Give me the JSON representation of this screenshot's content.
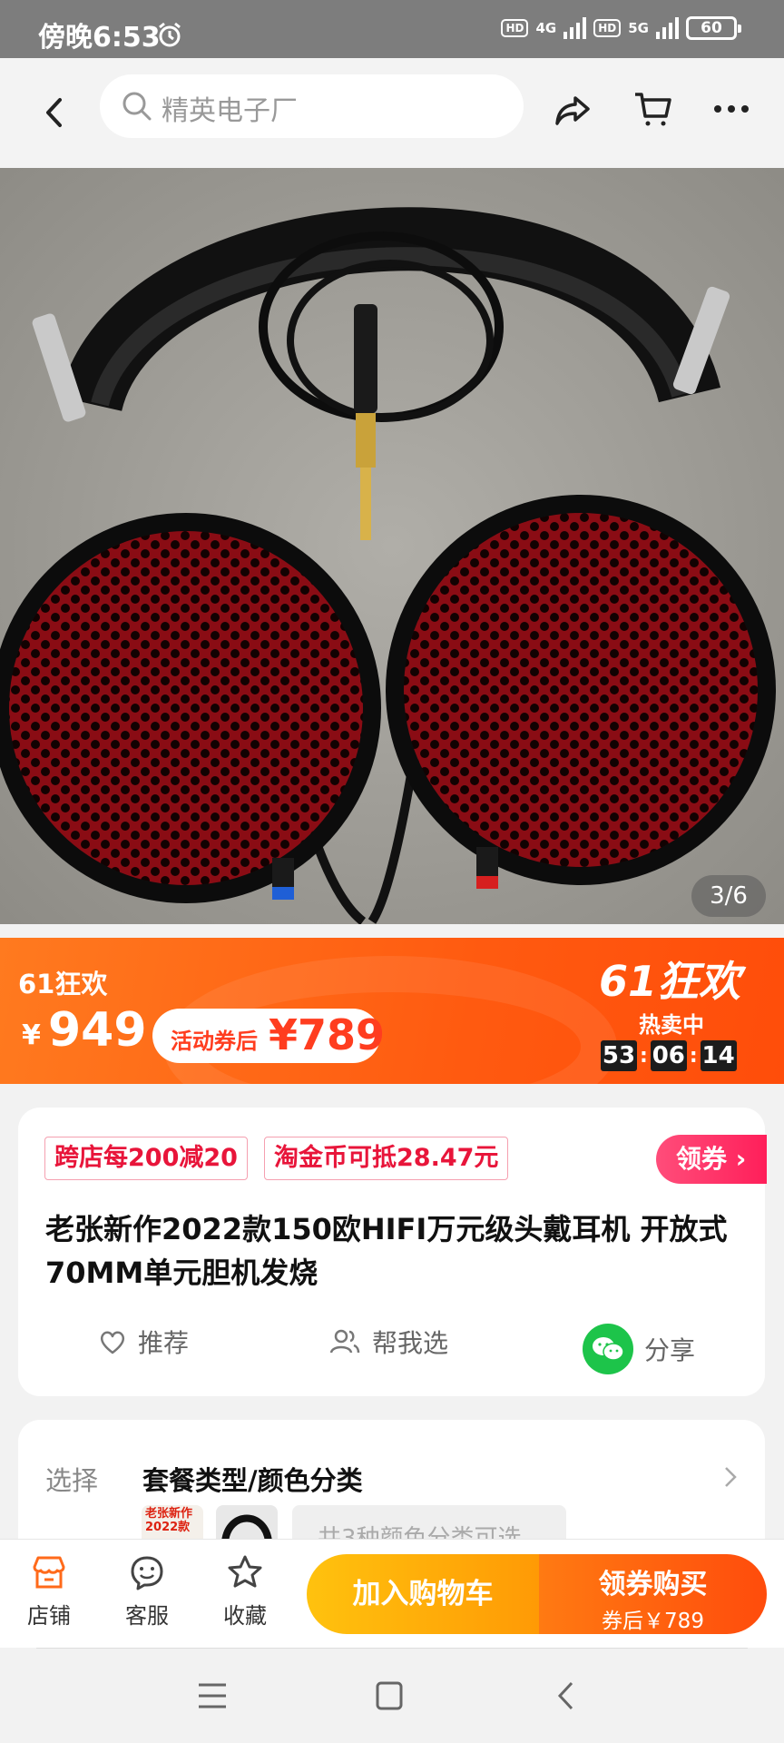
{
  "status_bar": {
    "time": "傍晚6:53",
    "net1": "4G",
    "net2": "5G",
    "hd": "HD",
    "battery": "60"
  },
  "nav": {
    "search_text": "精英电子厂",
    "icons": [
      "back-icon",
      "search-icon",
      "share-icon",
      "cart-icon",
      "more-icon"
    ]
  },
  "gallery": {
    "counter": "3/6"
  },
  "promo": {
    "tag": "61狂欢",
    "currency": "¥",
    "price": "949",
    "coupon_label": "活动券后",
    "coupon_price": "¥789",
    "brand": "61狂欢",
    "hot": "热卖中",
    "timer": [
      "53",
      "06",
      "14"
    ],
    "colors": {
      "band": "#ff5a10",
      "pill_text": "#ff3d1f"
    }
  },
  "product": {
    "coupons": [
      "跨店每200减20",
      "淘金币可抵28.47元"
    ],
    "get_coupon": "领券 ›",
    "title": "老张新作2022款150欧HIFI万元级头戴耳机 开放式70MM单元胆机发烧",
    "actions": {
      "recommend": "推荐",
      "help_choose": "帮我选",
      "share": "分享"
    }
  },
  "options": {
    "label": "选择",
    "value": "套餐类型/颜色分类",
    "thumb_text": "老张新作 2022款",
    "more": "共3种颜色分类可选"
  },
  "bottom": {
    "store": "店铺",
    "service": "客服",
    "favorite": "收藏",
    "add_cart": "加入购物车",
    "buy": "领券购买",
    "buy_sub": "券后￥789",
    "colors": {
      "cart": "#ffae0a",
      "buy": "#ff5a0c"
    }
  }
}
